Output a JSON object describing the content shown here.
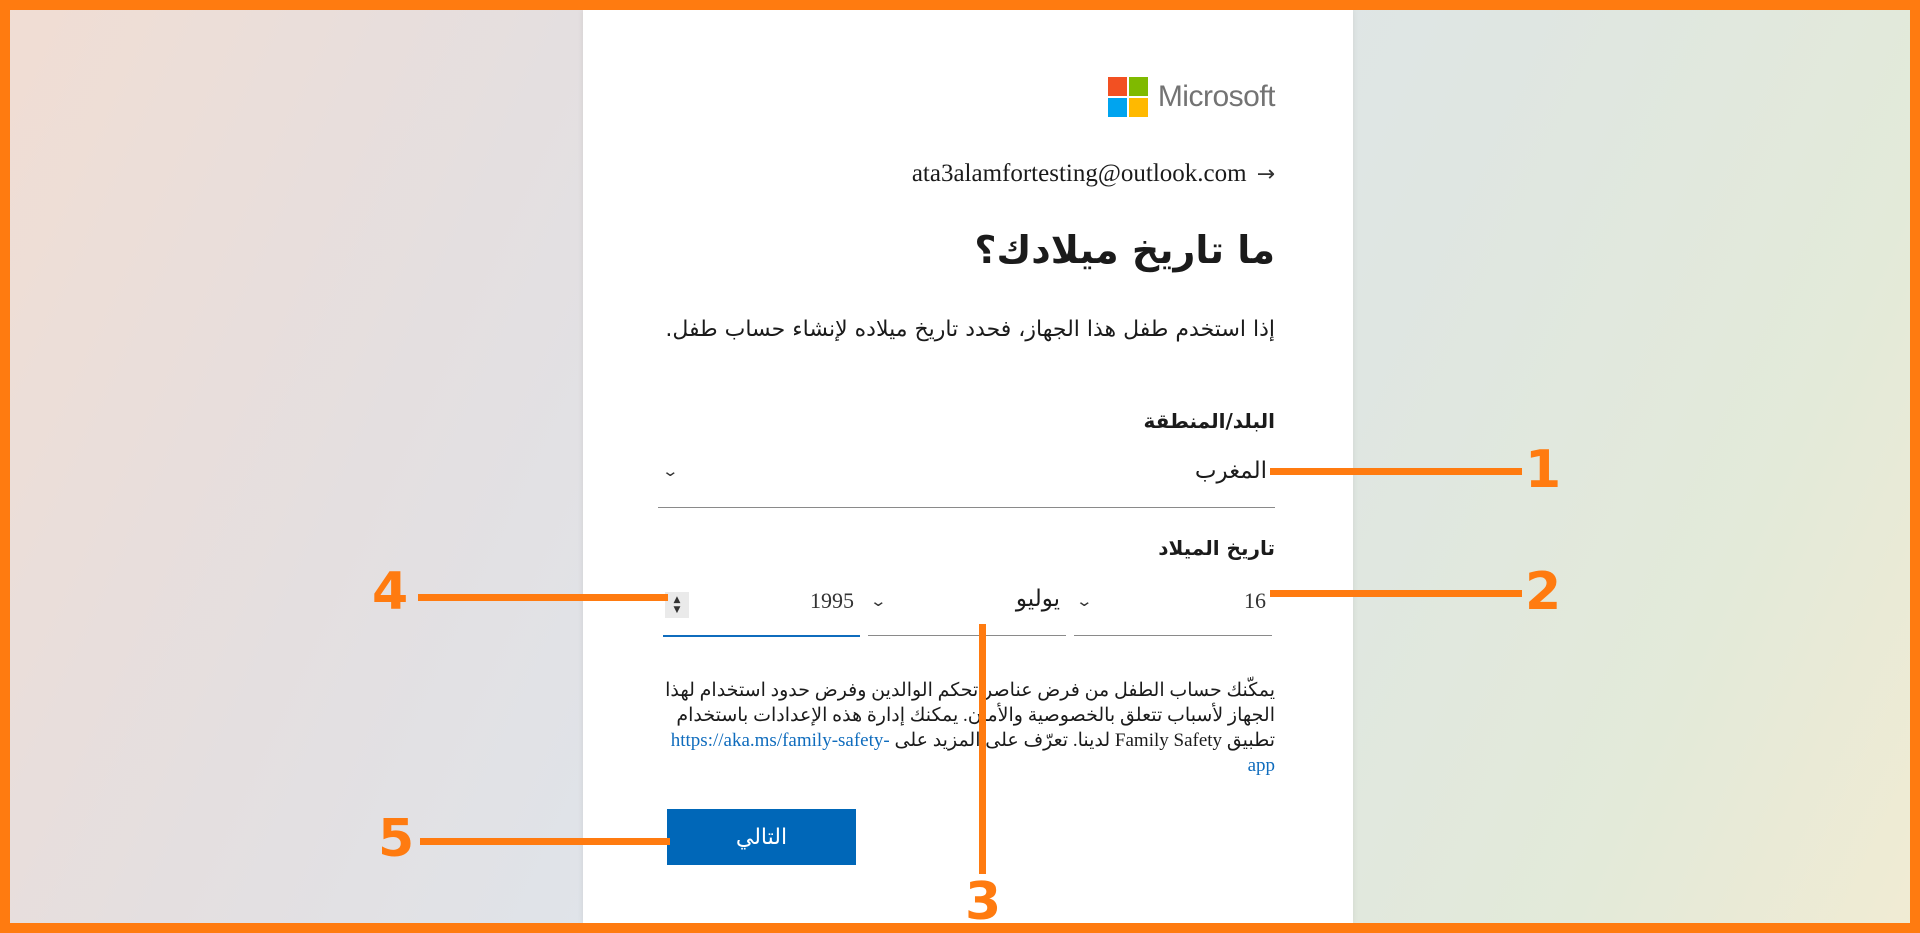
{
  "logo": {
    "text": "Microsoft",
    "colors": [
      "#f25022",
      "#7fba00",
      "#00a4ef",
      "#ffb900"
    ]
  },
  "account": {
    "email": "ata3alamfortesting@outlook.com",
    "back_icon": "→"
  },
  "page": {
    "title": "ما تاريخ ميلادك؟",
    "description": "إذا استخدم طفل هذا الجهاز، فحدد تاريخ ميلاده لإنشاء حساب طفل."
  },
  "country": {
    "label": "البلد/المنطقة",
    "value": "المغرب"
  },
  "birthdate": {
    "label": "تاريخ الميلاد",
    "day": "16",
    "month": "يوليو",
    "year": "1995"
  },
  "notice": {
    "text": "يمكّنك حساب الطفل من فرض عناصر تحكم الوالدين وفرض حدود استخدام لهذا الجهاز لأسباب تتعلق بالخصوصية والأمان. يمكنك إدارة هذه الإعدادات باستخدام تطبيق Family Safety لدينا. تعرّف على المزيد على",
    "link": "https://aka.ms/family-safety-app"
  },
  "buttons": {
    "next": "التالي"
  },
  "annotations": {
    "one": "1",
    "two": "2",
    "three": "3",
    "four": "4",
    "five": "5",
    "color": "#ff7b10"
  },
  "icons": {
    "chevron": "⌄",
    "spin_up": "▲",
    "spin_down": "▼"
  }
}
